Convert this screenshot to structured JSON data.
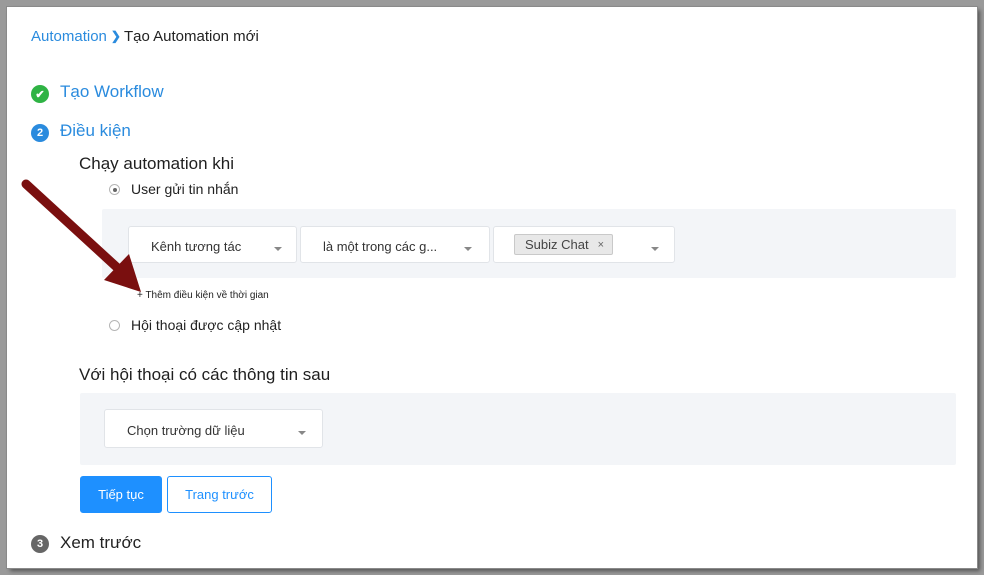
{
  "breadcrumb": {
    "root": "Automation",
    "separator": "❯",
    "current": "Tạo Automation mới"
  },
  "steps": [
    {
      "number": "✔",
      "title": "Tạo Workflow",
      "status": "done"
    },
    {
      "number": "2",
      "title": "Điều kiện",
      "status": "active"
    },
    {
      "number": "3",
      "title": "Xem trước",
      "status": "pending"
    }
  ],
  "conditions": {
    "run_when_title": "Chạy automation khi",
    "option_message": "User gửi tin nhắn",
    "option_message_selected": true,
    "channel_select": "Kênh tương tác",
    "operator_select": "là một trong các g...",
    "selected_tag": "Subiz Chat",
    "tag_remove": "×",
    "add_time_condition": "+ Thêm điều kiện về thời gian",
    "option_updated": "Hội thoại được cập nhật",
    "option_updated_selected": false
  },
  "conversation_filter": {
    "title": "Với hội thoại có các thông tin sau",
    "field_select": "Chọn trường dữ liệu"
  },
  "buttons": {
    "next": "Tiếp tục",
    "previous": "Trang trước"
  },
  "colors": {
    "accent": "#1e90ff",
    "link": "#2a8bde",
    "success": "#2fb344",
    "annotation_arrow": "#7a0f0f"
  }
}
